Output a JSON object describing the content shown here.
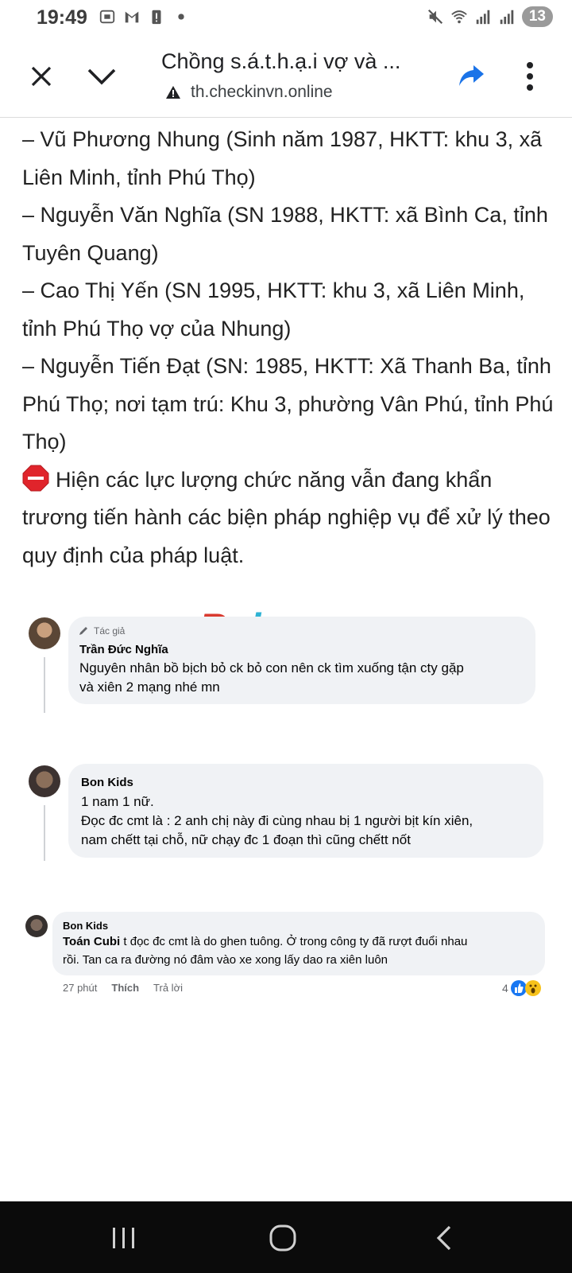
{
  "status_bar": {
    "time": "19:49",
    "battery": "13",
    "icons": [
      "screenshot-icon",
      "gmail-icon",
      "battery-alert-icon",
      "dot-icon",
      "mute-icon",
      "wifi-icon",
      "signal-icon",
      "signal-icon"
    ]
  },
  "toolbar": {
    "title": "Chồng s.á.t.h.ạ.i vợ và ...",
    "url": "th.checkinvn.online",
    "icons": [
      "close-icon",
      "chevron-down-icon",
      "warning-icon",
      "share-icon",
      "more-vert-icon"
    ]
  },
  "article": {
    "paragraphs": [
      "– Vũ Phương Nhung (Sinh năm 1987, HKTT: khu 3, xã Liên Minh, tỉnh Phú Thọ)",
      "– Nguyễn Văn Nghĩa (SN 1988, HKTT: xã Bình Ca, tỉnh Tuyên Quang)",
      "– Cao Thị Yến (SN 1995, HKTT: khu 3, xã Liên Minh, tỉnh Phú Thọ vợ của Nhung)",
      "– Nguyễn Tiến Đạt (SN: 1985, HKTT: Xã Thanh Ba, tỉnh Phú Thọ; nơi tạm trú: Khu 3, phường Vân Phú, tỉnh Phú Thọ)"
    ],
    "final_paragraph": "Hiện các lực lượng chức năng vẫn đang khẩn trương tiến hành các biện pháp nghiệp vụ để xử lý theo quy định của pháp luật."
  },
  "watermark": {
    "first": "R",
    "rest": "phang"
  },
  "comments": [
    {
      "badge": "Tác giả",
      "name": "Trần Đức Nghĩa",
      "lines": [
        "Nguyên nhân bồ bịch bỏ ck bỏ con nên ck tìm xuống tận cty gặp",
        "và xiên 2 mạng nhé mn"
      ]
    },
    {
      "name": "Bon Kids",
      "lines": [
        "1 nam 1 nữ.",
        "Đọc đc cmt là : 2 anh chị này đi cùng nhau bị 1 người bịt kín xiên,",
        "nam chếtt tại chỗ, nữ chạy đc 1 đoạn thì cũng chếtt nốt"
      ]
    },
    {
      "name": "Bon Kids",
      "mention": "Toán Cubi",
      "line1": " t đọc đc cmt là do ghen tuông. Ở trong công ty đã rượt đuổi nhau",
      "line2": "rồi. Tan ca ra đường nó đâm vào xe xong lấy dao ra xiên luôn",
      "time": "27 phút",
      "like": "Thích",
      "reply": "Trả lời",
      "reaction_count": "4"
    }
  ],
  "colors": {
    "bubble": "#f0f2f5",
    "like_blue": "#1877f2",
    "stop_red": "#e0242b",
    "nav_bg": "#0b0b0b"
  }
}
